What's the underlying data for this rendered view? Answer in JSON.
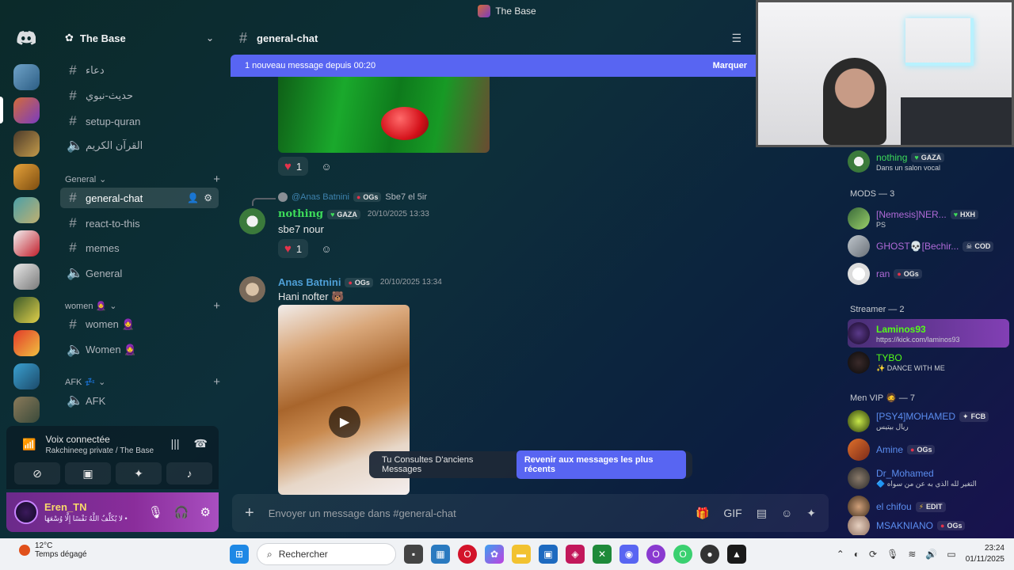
{
  "window": {
    "title": "The Base"
  },
  "server": {
    "name": "The Base"
  },
  "channels": [
    {
      "name": "دعاء",
      "type": "text"
    },
    {
      "name": "حديث-نبوي",
      "type": "text"
    },
    {
      "name": "setup-quran",
      "type": "text"
    },
    {
      "name": "القرآن الكريم",
      "type": "voice"
    }
  ],
  "categories": [
    {
      "name": "General",
      "channels": [
        {
          "name": "general-chat",
          "type": "text",
          "active": true
        },
        {
          "name": "react-to-this",
          "type": "text"
        },
        {
          "name": "memes",
          "type": "text"
        },
        {
          "name": "General",
          "type": "voice"
        }
      ]
    },
    {
      "name": "women 🧕",
      "channels": [
        {
          "name": "women 🧕",
          "type": "text"
        },
        {
          "name": "Women 🧕",
          "type": "voice"
        }
      ]
    },
    {
      "name": "AFK 💤",
      "channels": [
        {
          "name": "AFK",
          "type": "voice"
        }
      ]
    }
  ],
  "voice": {
    "title": "Voix connectée",
    "subtitle": "Rakchineeg private / The Base"
  },
  "user": {
    "name": "Eren_TN",
    "status": "لا يُكَلِّفُ اللَّهُ نَفْسًا إِلَّا وُسْعَهَا •"
  },
  "chat": {
    "channel": "general-chat",
    "new_messages": "1 nouveau message depuis 00:20",
    "mark_read": "Marquer",
    "messages": [
      {
        "reply_to_name": "@Anas Batnini",
        "reply_to_tag": "OGs",
        "reply_text": "Sbe7 el 5ir",
        "author": "nothing",
        "tag": "GAZA",
        "time": "20/10/2025 13:33",
        "text": "sbe7 nour",
        "reaction_count": "1"
      },
      {
        "author": "Anas Batnini",
        "tag": "OGs",
        "time": "20/10/2025 13:34",
        "text": "Hani nofter 🐻"
      }
    ],
    "first_reaction_count": "1",
    "old_messages_notice": "Tu Consultes D'anciens Messages",
    "jump_to_recent": "Revenir aux messages les plus récents",
    "composer_placeholder": "Envoyer un message dans #general-chat"
  },
  "members": {
    "top": {
      "name": "nothing",
      "tag": "GAZA",
      "sub": "Dans un salon vocal"
    },
    "groups": [
      {
        "title": "MODS — 3",
        "items": [
          {
            "name": "[Nemesis]NER...",
            "tag": "HXH",
            "sub": "PS",
            "color": "#b06ad8"
          },
          {
            "name": "GHOST💀[Bechir...",
            "tag": "COD",
            "sub": "",
            "color": "#b06ad8"
          },
          {
            "name": "ran",
            "tag": "OGs",
            "sub": "",
            "color": "#b06ad8"
          }
        ]
      },
      {
        "title": "Streamer — 2",
        "items": [
          {
            "name": "Laminos93",
            "tag": "",
            "sub": "https://kick.com/laminos93",
            "color": "#53fc18"
          },
          {
            "name": "TYBO",
            "tag": "",
            "sub": "✨ DANCE WITH ME",
            "color": "#53fc18"
          }
        ]
      },
      {
        "title": "Men VIP 🧔 — 7",
        "items": [
          {
            "name": "[PSY4]MOHAMED",
            "tag": "FCB",
            "sub": "ريال بيتيس",
            "color": "#5b8def"
          },
          {
            "name": "Amine",
            "tag": "OGs",
            "sub": "",
            "color": "#5b8def"
          },
          {
            "name": "Dr_Mohamed",
            "tag": "",
            "sub": "🔷 التغير لله الذي به عن من سواه",
            "color": "#5b8def"
          },
          {
            "name": "el chifou",
            "tag": "EDIT",
            "sub": "",
            "color": "#5b8def"
          },
          {
            "name": "MSAKNIANO",
            "tag": "OGs",
            "sub": "",
            "color": "#5b8def"
          }
        ]
      }
    ]
  },
  "taskbar": {
    "temperature": "12°C",
    "weather": "Temps dégagé",
    "search_placeholder": "Rechercher",
    "time": "23:24",
    "date": "01/11/2025"
  },
  "colors": {
    "accent": "#5865f2",
    "reaction_heart": "#e5334b"
  }
}
